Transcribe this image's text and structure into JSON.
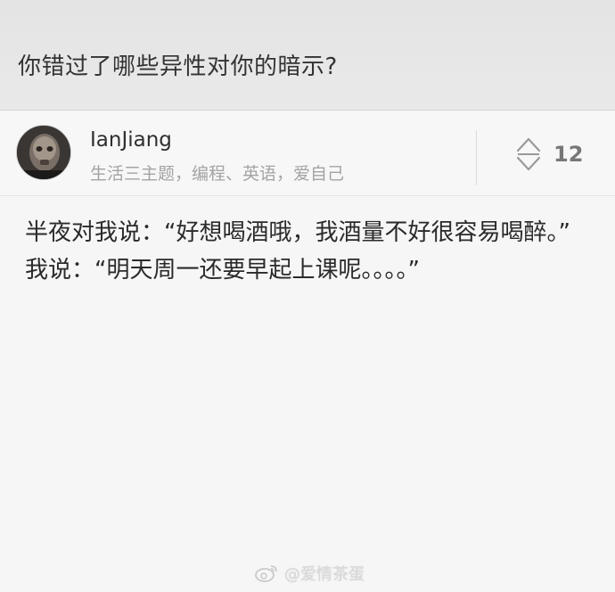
{
  "question": {
    "title": "你错过了哪些异性对你的暗示?"
  },
  "author": {
    "name": "IanJiang",
    "bio": "生活三主题，编程、英语，爱自己"
  },
  "vote": {
    "icon": "updown-arrow-icon",
    "count": "12"
  },
  "answer": {
    "lines": [
      "半夜对我说：“好想喝酒哦，我酒量不好很容易喝醉。”",
      "我说：“明天周一还要早起上课呢。。。。”"
    ]
  },
  "watermark": {
    "icon": "weibo-icon",
    "text": "@爱情茶蛋"
  }
}
